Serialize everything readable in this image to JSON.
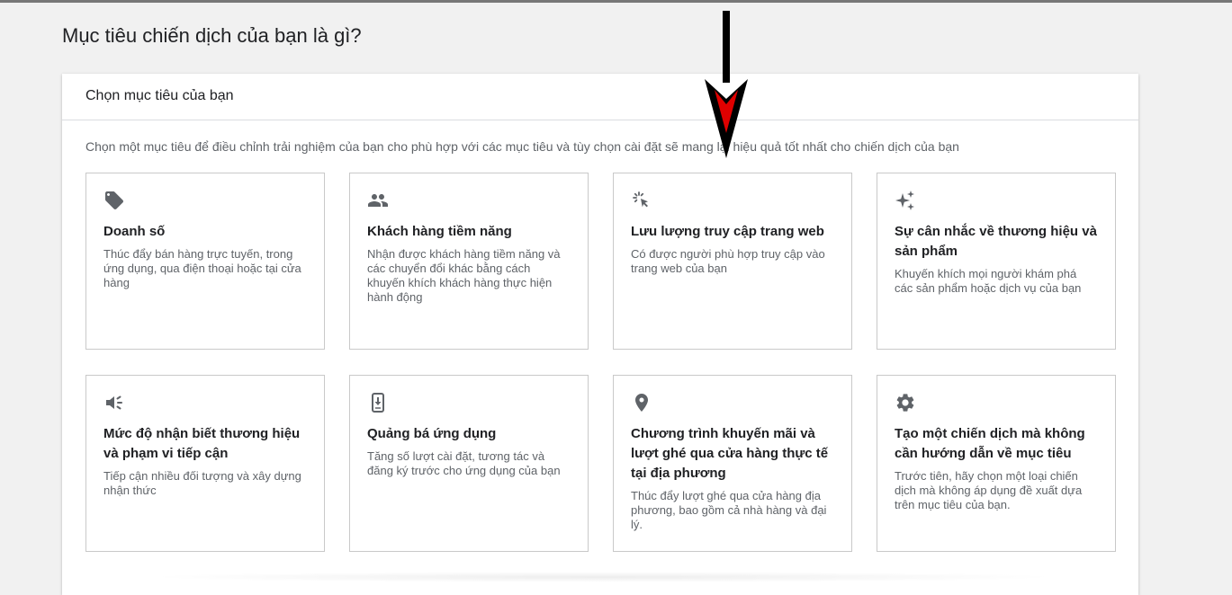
{
  "page": {
    "title": "Mục tiêu chiến dịch của bạn là gì?"
  },
  "panel": {
    "header": "Chọn mục tiêu của bạn",
    "description": "Chọn một mục tiêu để điều chỉnh trải nghiệm của bạn cho phù hợp với các mục tiêu và tùy chọn cài đặt sẽ mang lại hiệu quả tốt nhất cho chiến dịch của bạn"
  },
  "cards": [
    {
      "icon": "tag-icon",
      "title": "Doanh số",
      "desc": "Thúc đẩy bán hàng trực tuyến, trong ứng dụng, qua điện thoại hoặc tại cửa hàng"
    },
    {
      "icon": "people-icon",
      "title": "Khách hàng tiềm năng",
      "desc": "Nhận được khách hàng tiềm năng và các chuyển đổi khác bằng cách khuyến khích khách hàng thực hiện hành động"
    },
    {
      "icon": "cursor-click-icon",
      "title": "Lưu lượng truy cập trang web",
      "desc": "Có được người phù hợp truy cập vào trang web của bạn"
    },
    {
      "icon": "sparkle-icon",
      "title": "Sự cân nhắc về thương hiệu và sản phẩm",
      "desc": "Khuyến khích mọi người khám phá các sản phẩm hoặc dịch vụ của bạn"
    },
    {
      "icon": "megaphone-icon",
      "title": "Mức độ nhận biết thương hiệu và phạm vi tiếp cận",
      "desc": "Tiếp cận nhiều đối tượng và xây dựng nhận thức"
    },
    {
      "icon": "phone-download-icon",
      "title": "Quảng bá ứng dụng",
      "desc": "Tăng số lượt cài đặt, tương tác và đăng ký trước cho ứng dụng của bạn"
    },
    {
      "icon": "location-pin-icon",
      "title": "Chương trình khuyến mãi và lượt ghé qua cửa hàng thực tế tại địa phương",
      "desc": "Thúc đẩy lượt ghé qua cửa hàng địa phương, bao gồm cả nhà hàng và đại lý."
    },
    {
      "icon": "gear-icon",
      "title": "Tạo một chiến dịch mà không cần hướng dẫn về mục tiêu",
      "desc": "Trước tiên, hãy chọn một loại chiến dịch mà không áp dụng đề xuất dựa trên mục tiêu của bạn."
    }
  ],
  "colors": {
    "icon": "#5f6368",
    "arrow_fill": "#e00000",
    "arrow_outline": "#000000"
  }
}
